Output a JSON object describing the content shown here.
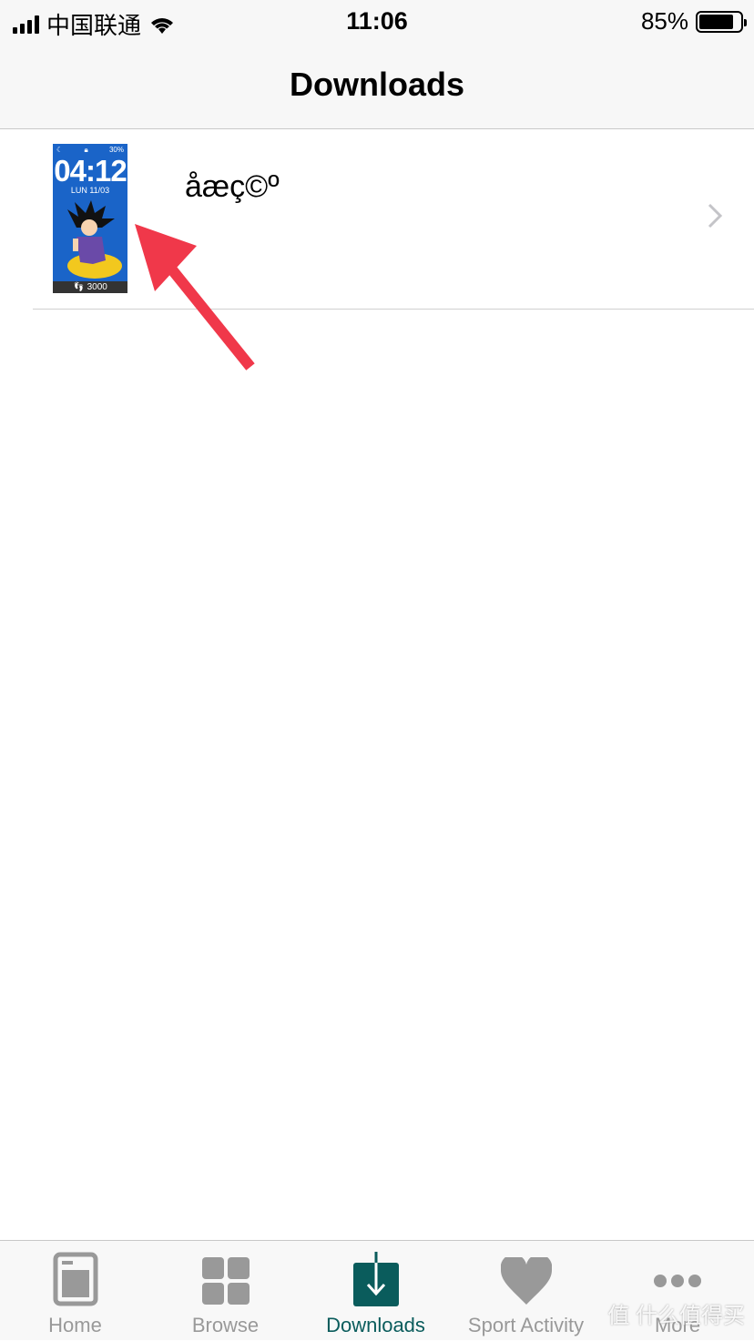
{
  "status_bar": {
    "carrier": "中国联通",
    "time": "11:06",
    "battery": "85%",
    "battery_level": 0.85
  },
  "nav": {
    "title": "Downloads"
  },
  "downloads": [
    {
      "title": "åæç©º",
      "thumbnail": {
        "status": "30%",
        "clock": "04:12",
        "date": "LUN 11/03",
        "steps": "3000"
      }
    }
  ],
  "annotation": {
    "arrow_color": "#f0384a"
  },
  "tabbar": {
    "active_color": "#0a5c5c",
    "inactive_color": "#9a9a9a",
    "tabs": [
      {
        "label": "Home",
        "icon": "home-icon"
      },
      {
        "label": "Browse",
        "icon": "grid-icon"
      },
      {
        "label": "Downloads",
        "icon": "download-icon",
        "active": true
      },
      {
        "label": "Sport Activity",
        "icon": "heart-icon"
      },
      {
        "label": "More",
        "icon": "more-icon"
      }
    ]
  },
  "watermark": "值 什么值得买"
}
